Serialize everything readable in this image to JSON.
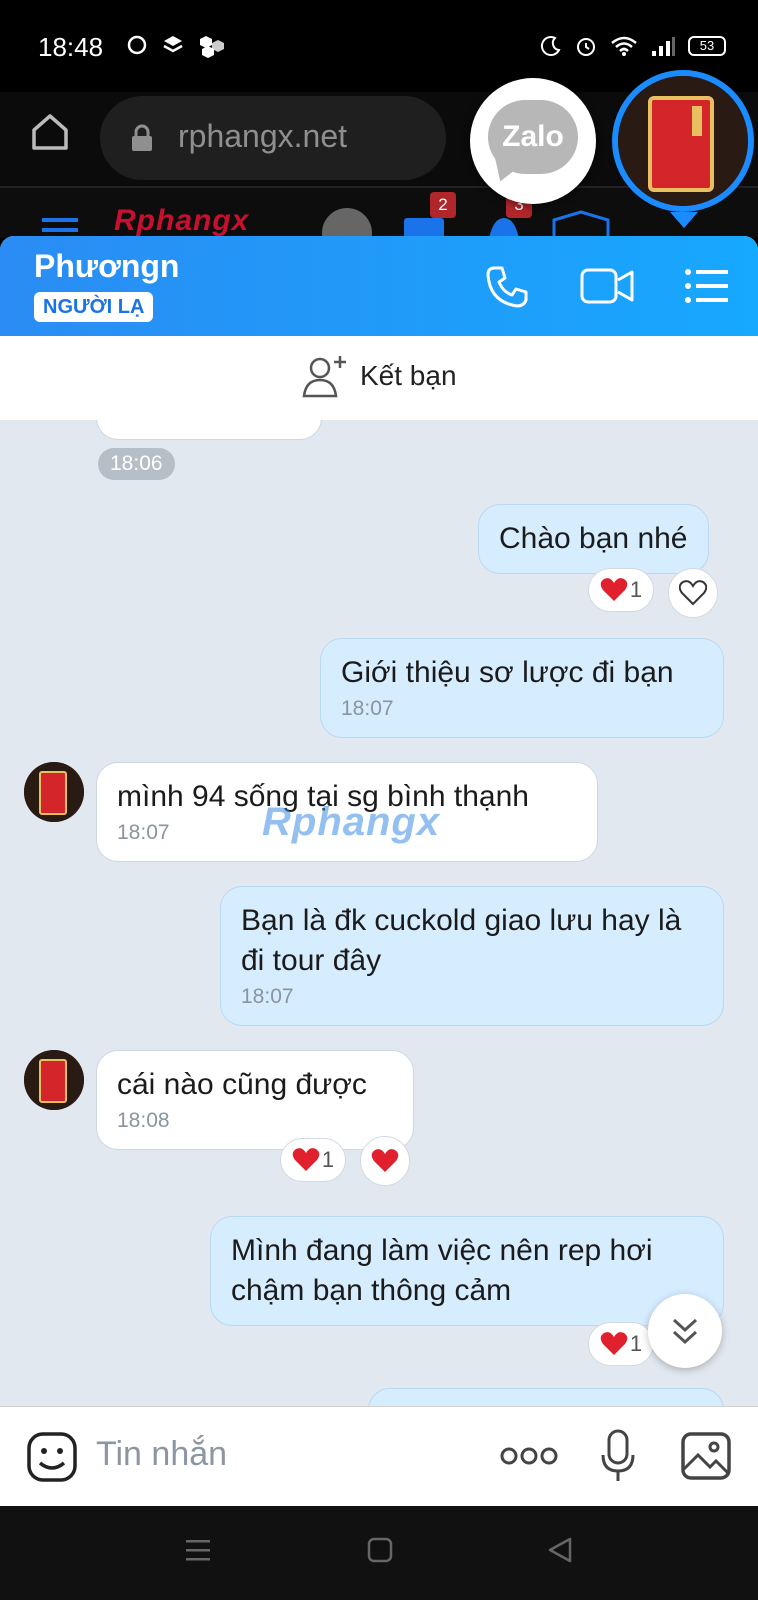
{
  "status_bar": {
    "time": "18:48",
    "battery": "53"
  },
  "browser": {
    "url": "rphangx.net",
    "site_logo": "Rphangx",
    "mail_count": "2",
    "notif_count": "3"
  },
  "zalo_bubble": {
    "label": "Zalo"
  },
  "chat": {
    "contact_name": "Phươngn",
    "contact_tag": "NGƯỜI LẠ",
    "add_friend_label": "Kết bạn",
    "time_pill": "18:06",
    "messages": [
      {
        "dir": "out",
        "text": "Chào bạn nhé",
        "time": "",
        "reaction_count": "1"
      },
      {
        "dir": "out",
        "text": "Giới thiệu sơ lược đi bạn",
        "time": "18:07"
      },
      {
        "dir": "in",
        "text": "mình 94 sống tại sg bình thạnh",
        "time": "18:07"
      },
      {
        "dir": "out",
        "text": "Bạn là đk cuckold giao lưu hay là đi tour đây",
        "time": "18:07"
      },
      {
        "dir": "in",
        "text": "cái nào cũng được",
        "time": "18:08",
        "reaction_count": "1"
      },
      {
        "dir": "out",
        "text": "Mình đang làm việc nên rep hơi chậm bạn thông cảm",
        "time": "",
        "reaction_count": "1"
      }
    ],
    "watermark": "Rphangx"
  },
  "composer": {
    "placeholder": "Tin nhắn"
  },
  "colors": {
    "header_start": "#2a8cf4",
    "header_end": "#17a8ff",
    "out_bubble": "#d6ecff",
    "heart": "#e0202c"
  }
}
